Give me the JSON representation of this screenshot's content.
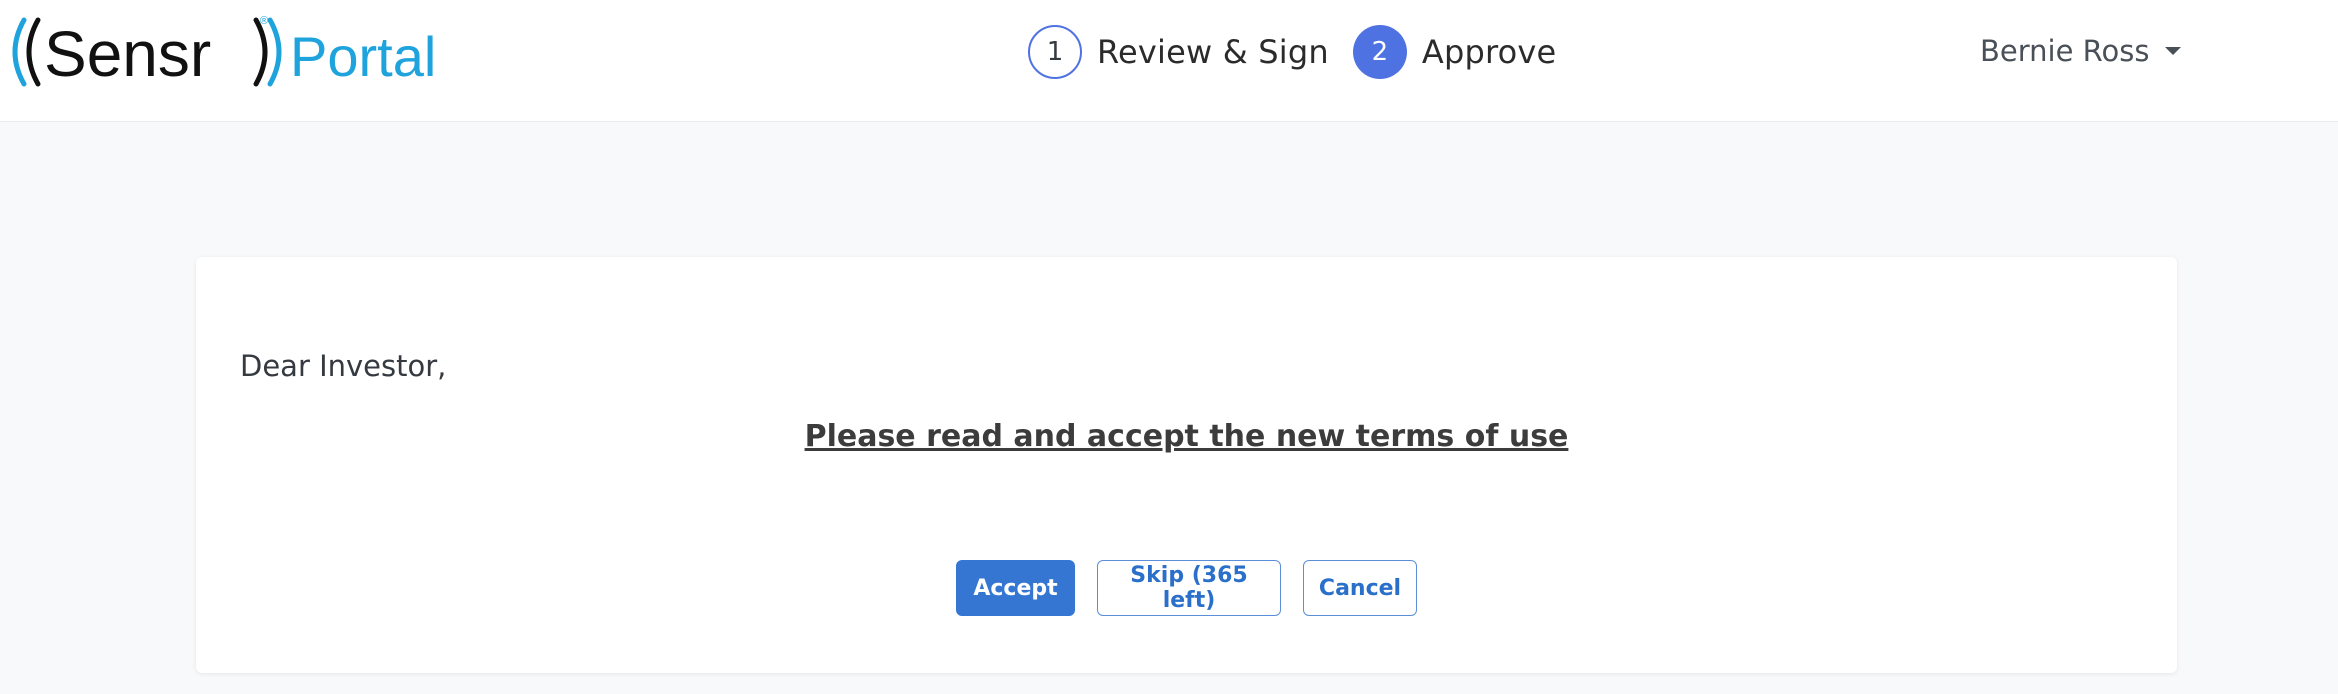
{
  "logo": {
    "brand": "Sensr",
    "product": "Portal",
    "registered": "®"
  },
  "steps": [
    {
      "number": "1",
      "label": "Review & Sign",
      "state": "outline"
    },
    {
      "number": "2",
      "label": "Approve",
      "state": "active"
    }
  ],
  "user": {
    "name": "Bernie Ross"
  },
  "content": {
    "greeting": "Dear Investor,",
    "heading": "Please read and accept the new terms of use"
  },
  "actions": {
    "accept": "Accept",
    "skip": "Skip (365 left)",
    "cancel": "Cancel"
  },
  "colors": {
    "accent": "#4f72e3",
    "primary_button": "#3476d2",
    "logo_blue": "#1ea3dc",
    "background": "#f8f9fa"
  }
}
